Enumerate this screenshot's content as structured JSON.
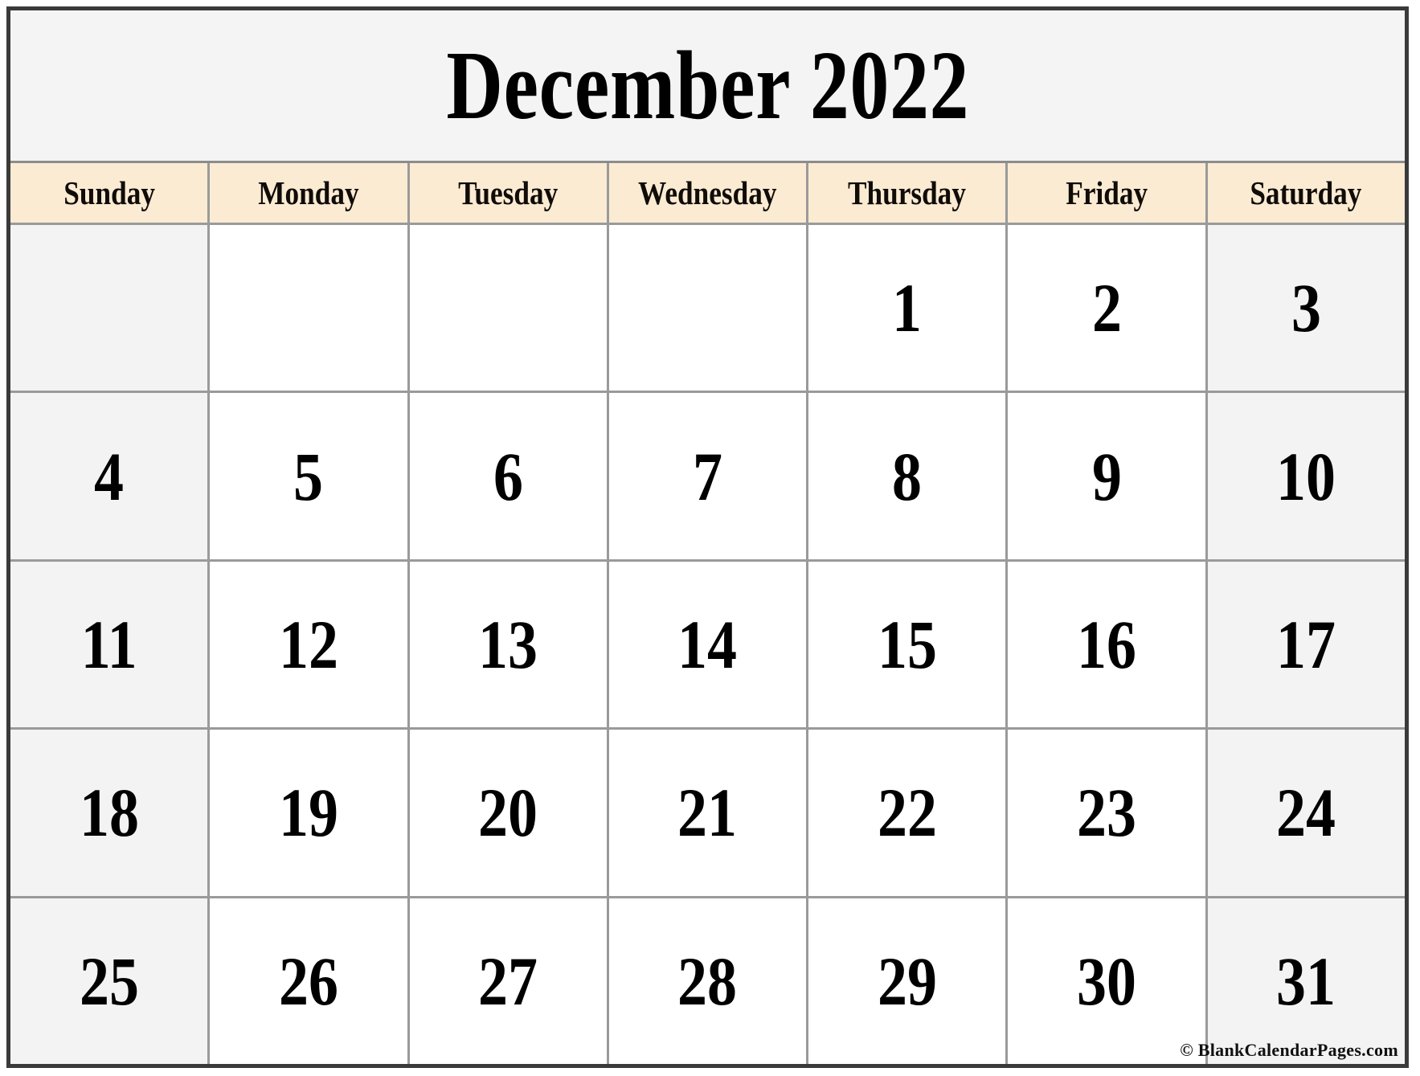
{
  "title": "December 2022",
  "month": "December",
  "year": "2022",
  "weekday_headers": [
    "Sunday",
    "Monday",
    "Tuesday",
    "Wednesday",
    "Thursday",
    "Friday",
    "Saturday"
  ],
  "weeks": [
    [
      "",
      "",
      "",
      "",
      "1",
      "2",
      "3"
    ],
    [
      "4",
      "5",
      "6",
      "7",
      "8",
      "9",
      "10"
    ],
    [
      "11",
      "12",
      "13",
      "14",
      "15",
      "16",
      "17"
    ],
    [
      "18",
      "19",
      "20",
      "21",
      "22",
      "23",
      "24"
    ],
    [
      "25",
      "26",
      "27",
      "28",
      "29",
      "30",
      "31"
    ]
  ],
  "credit": "© BlankCalendarPages.com",
  "colors": {
    "header_background": "#FBEBD3",
    "weekend_background": "#F3F3F3",
    "weekday_background": "#FFFFFF",
    "title_background": "#F4F4F4",
    "grid_line": "#9A9A9A",
    "outer_border": "#3A3A3A",
    "text": "#000000"
  }
}
